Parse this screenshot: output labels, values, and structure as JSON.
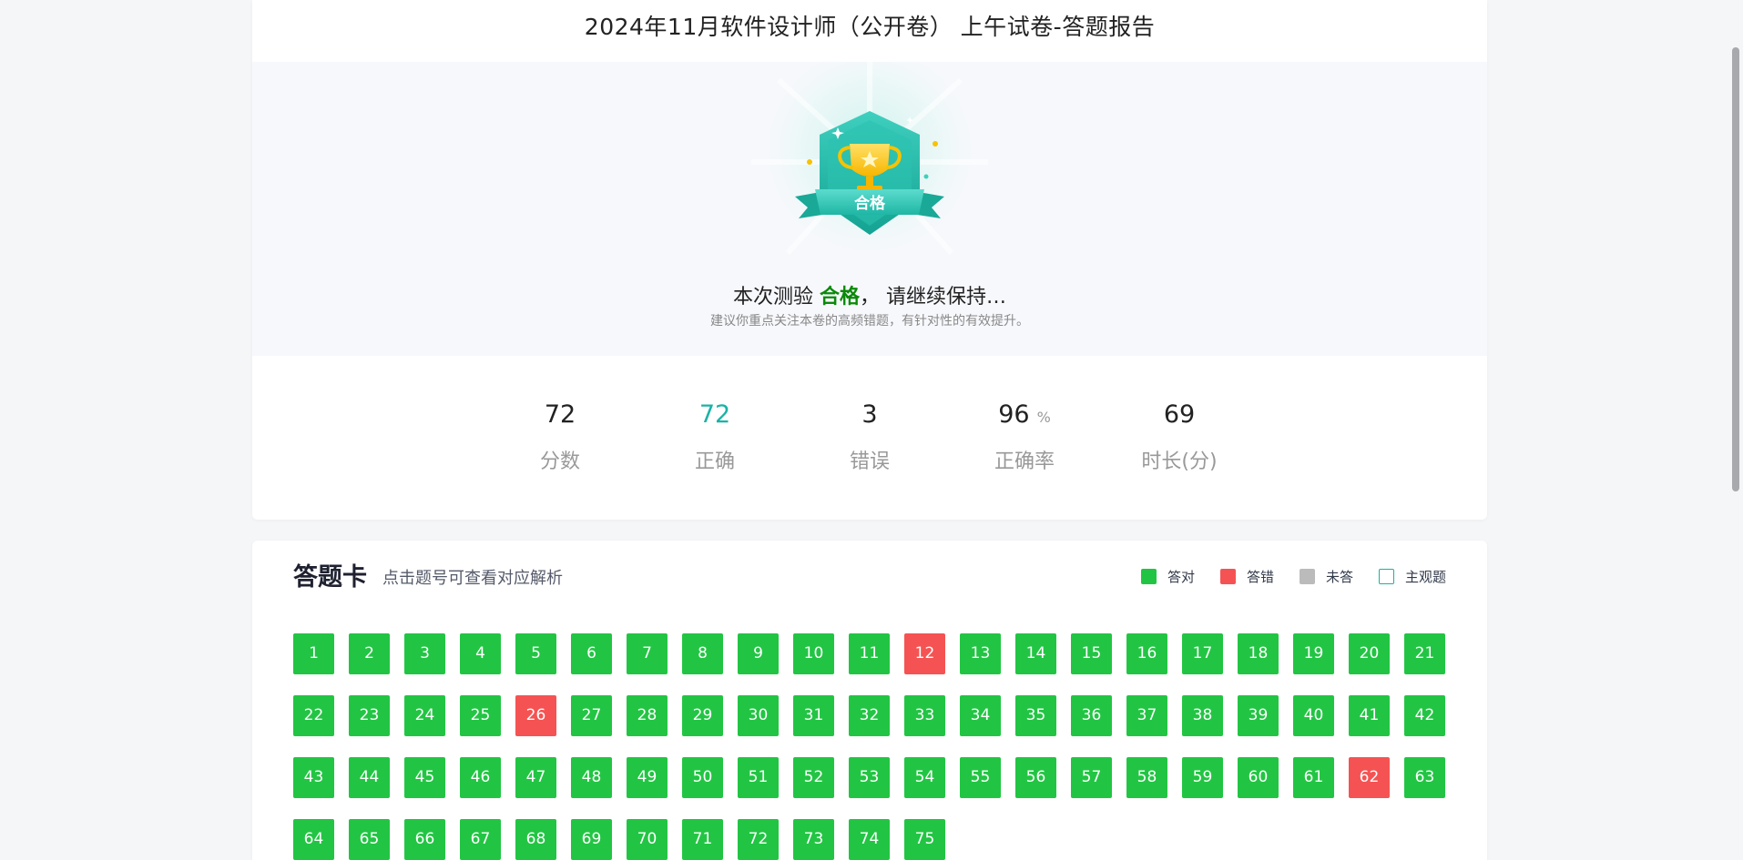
{
  "report": {
    "title": "2024年11月软件设计师（公开卷） 上午试卷-答题报告",
    "badge_text": "合格",
    "result_prefix": "本次测验 ",
    "result_status": "合格",
    "result_suffix": "， 请继续保持…",
    "result_sub": "建议你重点关注本卷的高频错题，有针对性的有效提升。"
  },
  "stats": [
    {
      "value": "72",
      "unit": "",
      "label": "分数"
    },
    {
      "value": "72",
      "unit": "",
      "label": "正确"
    },
    {
      "value": "3",
      "unit": "",
      "label": "错误"
    },
    {
      "value": "96",
      "unit": "%",
      "label": "正确率"
    },
    {
      "value": "69",
      "unit": "",
      "label": "时长(分)"
    }
  ],
  "answer_card": {
    "title": "答题卡",
    "hint": "点击题号可查看对应解析",
    "legend": {
      "correct": "答对",
      "wrong": "答错",
      "unanswered": "未答",
      "subjective": "主观题"
    },
    "wrong_questions": [
      12,
      26,
      62
    ],
    "total_visible": 75
  },
  "colors": {
    "correct": "#22c543",
    "wrong": "#f55353",
    "unanswered": "#bbbbbb",
    "subjective_border": "#18b2a2",
    "accent_teal": "#1ab3a6",
    "pass_green": "#0a8a0a"
  }
}
